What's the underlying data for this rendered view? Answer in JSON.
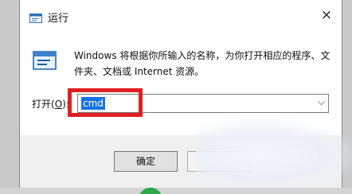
{
  "window": {
    "title": "运行",
    "title_icon": "run-icon",
    "close_glyph": "×"
  },
  "main": {
    "description": "Windows 将根据你所输入的名称，为你打开相应的程序、文件夹、文档或 Internet 资源。",
    "open_label_prefix": "打开(",
    "open_label_key": "O",
    "open_label_suffix": "):",
    "open_value": "cmd",
    "dropdown_glyph": "⌵"
  },
  "buttons": {
    "ok_label": "确定"
  },
  "colors": {
    "highlight_border": "#e02020",
    "selection": "#1473e6"
  }
}
